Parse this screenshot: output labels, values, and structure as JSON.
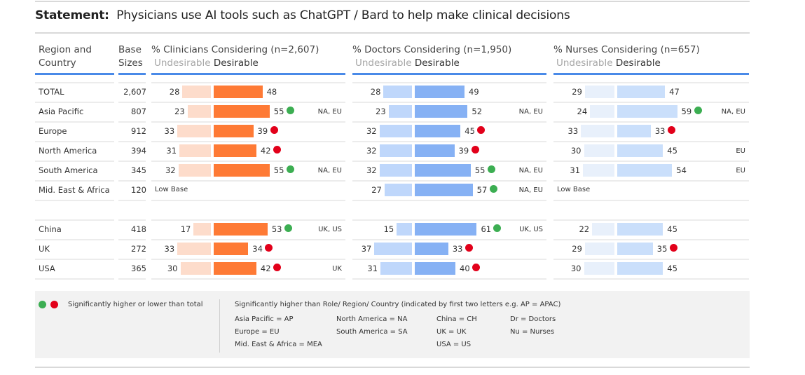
{
  "title": {
    "prefix": "Statement:",
    "text": "Physicians use AI tools such as ChatGPT / Bard to help make clinical decisions"
  },
  "headers": {
    "region": [
      "Region and",
      "Country"
    ],
    "base": [
      "Base",
      "Sizes"
    ],
    "undesirable": "Undesirable",
    "desirable": "Desirable"
  },
  "colors": {
    "clinicians_undesirable": "#fddccb",
    "clinicians_desirable": "#fe7a35",
    "doctors_undesirable": "#bfd7fb",
    "doctors_desirable": "#86b1f4",
    "nurses_undesirable": "#e8f0fb",
    "nurses_desirable": "#cadffb",
    "sig_higher": "#3cae52",
    "sig_lower": "#e2001a",
    "accent_line": "#4a8ae8"
  },
  "chart_data": {
    "type": "bar",
    "title": "Statement: Physicians use AI tools such as ChatGPT / Bard to help make clinical decisions",
    "orientation": "horizontal diverging",
    "categories": [
      "TOTAL",
      "Asia Pacific",
      "Europe",
      "North America",
      "South America",
      "Mid. East & Africa",
      "China",
      "UK",
      "USA"
    ],
    "base_sizes": [
      "2,607",
      "807",
      "912",
      "394",
      "345",
      "120",
      "418",
      "272",
      "365"
    ],
    "low_base_label": "Low Base",
    "panels": [
      {
        "key": "clinicians",
        "title": "% Clinicians Considering (n=2,607)",
        "series": [
          {
            "name": "Undesirable",
            "values": [
              28,
              23,
              33,
              31,
              32,
              null,
              17,
              33,
              30
            ]
          },
          {
            "name": "Desirable",
            "values": [
              48,
              55,
              39,
              42,
              55,
              null,
              53,
              34,
              42
            ]
          }
        ],
        "significance": [
          null,
          "higher",
          "lower",
          "lower",
          "higher",
          null,
          "higher",
          "lower",
          "lower"
        ],
        "sig_vs": [
          "",
          "NA, EU",
          "",
          "",
          "NA, EU",
          "",
          "UK, US",
          "",
          "UK"
        ],
        "low_base": [
          false,
          false,
          false,
          false,
          false,
          true,
          false,
          false,
          false
        ]
      },
      {
        "key": "doctors",
        "title": "% Doctors Considering (n=1,950)",
        "series": [
          {
            "name": "Undesirable",
            "values": [
              28,
              23,
              32,
              32,
              32,
              27,
              15,
              37,
              31
            ]
          },
          {
            "name": "Desirable",
            "values": [
              49,
              52,
              45,
              39,
              55,
              57,
              61,
              33,
              40
            ]
          }
        ],
        "significance": [
          null,
          null,
          "lower",
          "lower",
          "higher",
          "higher",
          "higher",
          "lower",
          "lower"
        ],
        "sig_vs": [
          "",
          "NA, EU",
          "",
          "",
          "NA, EU",
          "NA, EU",
          "UK, US",
          "",
          ""
        ],
        "low_base": [
          false,
          false,
          false,
          false,
          false,
          false,
          false,
          false,
          false
        ]
      },
      {
        "key": "nurses",
        "title": "% Nurses Considering (n=657)",
        "series": [
          {
            "name": "Undesirable",
            "values": [
              29,
              24,
              33,
              30,
              31,
              null,
              22,
              29,
              30
            ]
          },
          {
            "name": "Desirable",
            "values": [
              47,
              59,
              33,
              45,
              54,
              null,
              45,
              35,
              45
            ]
          }
        ],
        "significance": [
          null,
          "higher",
          "lower",
          null,
          null,
          null,
          null,
          "lower",
          null
        ],
        "sig_vs": [
          "",
          "NA, EU",
          "",
          "EU",
          "EU",
          "",
          "",
          "",
          ""
        ],
        "low_base": [
          false,
          false,
          false,
          false,
          false,
          true,
          false,
          false,
          false
        ]
      }
    ]
  },
  "legend": {
    "dots_label": "Significantly higher or lower than total",
    "sig_heading": "Significantly higher than Role/ Region/ Country (indicated by first two letters e.g. AP = APAC)",
    "columns": [
      [
        "Asia Pacific = AP",
        "Europe = EU",
        "Mid. East & Africa = MEA"
      ],
      [
        "North America  = NA",
        "South America = SA"
      ],
      [
        "China = CH",
        "UK = UK",
        "USA = US"
      ],
      [
        "Dr = Doctors",
        "Nu = Nurses"
      ]
    ]
  }
}
